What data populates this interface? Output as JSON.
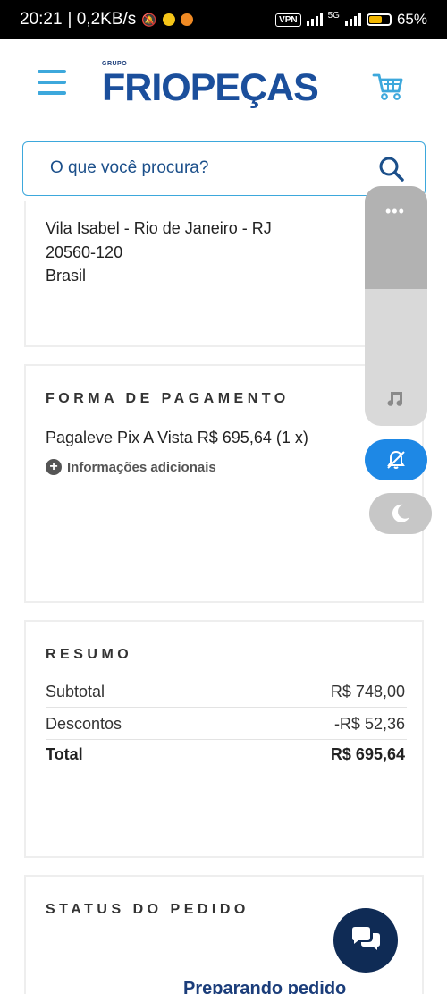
{
  "status_bar": {
    "time": "20:21",
    "network_speed": "| 0,2KB/s",
    "vpn_label": "VPN",
    "network_type": "5G",
    "battery_percent": "65%",
    "battery_level": 0.65
  },
  "header": {
    "logo_small": "GRUPO",
    "logo_main": "FRIOPEÇAS",
    "brand_color": "#1b4f9c",
    "accent_color": "#3da8dc"
  },
  "search": {
    "placeholder": "O que você procura?"
  },
  "address": {
    "line1": "Vila Isabel - Rio de Janeiro - RJ",
    "line2": "20560-120",
    "line3": "Brasil"
  },
  "payment": {
    "title": "FORMA DE PAGAMENTO",
    "method": "Pagaleve Pix A Vista R$ 695,64 (1 x)",
    "info_link": "Informações adicionais"
  },
  "summary": {
    "title": "RESUMO",
    "rows": [
      {
        "label": "Subtotal",
        "value": "R$ 748,00"
      },
      {
        "label": "Descontos",
        "value": "-R$ 52,36"
      },
      {
        "label": "Total",
        "value": "R$ 695,64"
      }
    ]
  },
  "order_status": {
    "title": "STATUS DO PEDIDO",
    "current": "Preparando pedido"
  },
  "overlay": {
    "volume_dots": "•••",
    "music_icon": "music-note-icon",
    "mute_icon": "bell-off-icon",
    "moon_icon": "moon-icon",
    "active_color": "#1e88e5"
  },
  "chat": {
    "icon": "chat-bubbles-icon",
    "color": "#0f2b55"
  }
}
